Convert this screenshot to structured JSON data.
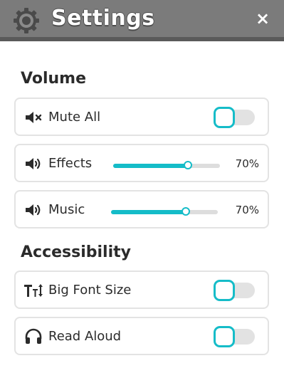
{
  "header": {
    "title": "Settings",
    "close_label": "×",
    "icon": "gear-icon",
    "bg_color": "#7b7b7b"
  },
  "volume": {
    "heading": "Volume",
    "mute_all": {
      "label": "Mute All",
      "icon": "speaker-mute-icon",
      "enabled": false
    },
    "effects": {
      "label": "Effects",
      "icon": "speaker-icon",
      "value": 70,
      "value_text": "70%"
    },
    "music": {
      "label": "Music",
      "icon": "speaker-icon",
      "value": 70,
      "value_text": "70%"
    }
  },
  "accessibility": {
    "heading": "Accessibility",
    "big_font_size": {
      "label": "Big Font Size",
      "icon": "text-size-icon",
      "enabled": false
    },
    "read_aloud": {
      "label": "Read Aloud",
      "icon": "headphones-icon",
      "enabled": false
    }
  },
  "colors": {
    "accent": "#15bcc8"
  }
}
